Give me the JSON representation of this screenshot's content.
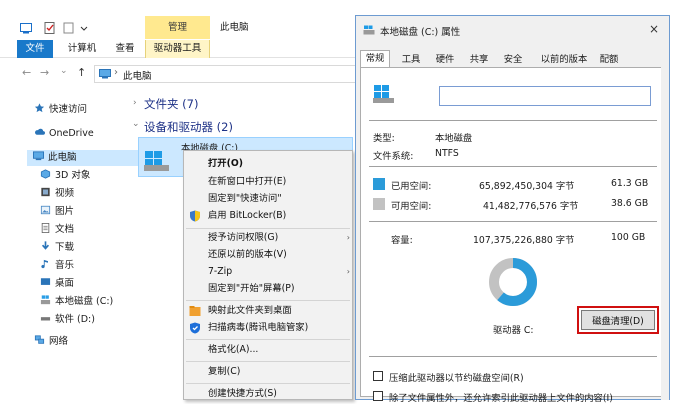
{
  "explorer": {
    "ribbon": {
      "context_group": "管理",
      "window_title": "此电脑",
      "tabs": {
        "file": "文件",
        "computer": "计算机",
        "view": "查看",
        "drive_tools": "驱动器工具"
      }
    },
    "address": {
      "back": "←",
      "forward": "→",
      "dropdown": "⌄",
      "up": "↑",
      "location": "此电脑",
      "sep": "›"
    },
    "sidebar": {
      "quick_access": "快速访问",
      "onedrive": "OneDrive",
      "this_pc": "此电脑",
      "objects3d": "3D 对象",
      "videos": "视频",
      "pictures": "图片",
      "documents": "文档",
      "downloads": "下载",
      "music": "音乐",
      "desktop": "桌面",
      "local_disk": "本地磁盘 (C:)",
      "software": "软件 (D:)",
      "network": "网络"
    },
    "groups": {
      "folders": "文件夹 (7)",
      "devices": "设备和驱动器 (2)"
    },
    "drive": {
      "name": "本地磁盘 (C:)"
    }
  },
  "context_menu": {
    "open": "打开(O)",
    "open_new_window": "在新窗口中打开(E)",
    "pin_quick": "固定到\"快速访问\"",
    "bitlocker": "启用 BitLocker(B)",
    "grant_access": "授予访问权限(G)",
    "restore_prev": "还原以前的版本(V)",
    "zip": "7-Zip",
    "pin_start": "固定到\"开始\"屏幕(P)",
    "map_desktop": "映射此文件夹到桌面",
    "scan_virus": "扫描病毒(腾讯电脑管家)",
    "format": "格式化(A)...",
    "copy": "复制(C)",
    "create_shortcut": "创建快捷方式(S)"
  },
  "dialog": {
    "title": "本地磁盘 (C:) 属性",
    "close": "×",
    "tabs": {
      "general": "常规",
      "tools": "工具",
      "hardware": "硬件",
      "sharing": "共享",
      "security": "安全",
      "prev_versions": "以前的版本",
      "quota": "配额"
    },
    "name_value": "",
    "type_label": "类型:",
    "type_value": "本地磁盘",
    "fs_label": "文件系统:",
    "fs_value": "NTFS",
    "used_label": "已用空间:",
    "used_bytes": "65,892,450,304 字节",
    "used_size": "61.3 GB",
    "free_label": "可用空间:",
    "free_bytes": "41,482,776,576 字节",
    "free_size": "38.6 GB",
    "cap_label": "容量:",
    "cap_bytes": "107,375,226,880 字节",
    "cap_size": "100 GB",
    "used_fraction": 0.613,
    "drive_label": "驱动器 C:",
    "cleanup": "磁盘清理(D)",
    "compress": "压缩此驱动器以节约磁盘空间(R)",
    "index": "除了文件属性外，还允许索引此驱动器上文件的内容(I)",
    "colors": {
      "used": "#2b9bd9",
      "free": "#c2c2c2"
    }
  }
}
